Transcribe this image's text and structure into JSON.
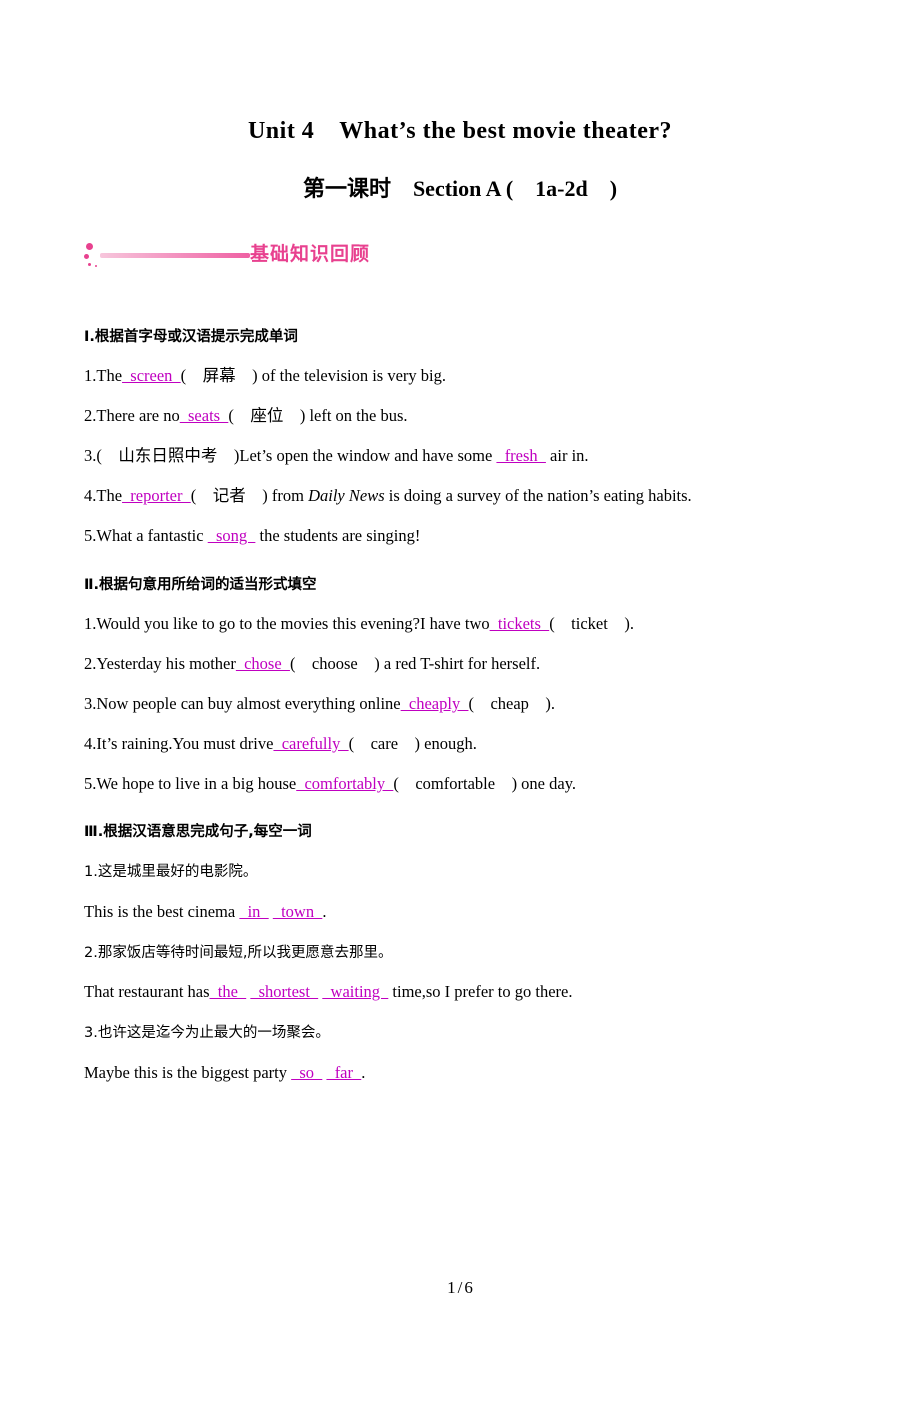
{
  "title": {
    "main": "Unit 4  What’s the best movie theater?",
    "sub": "第一课时  Section A (  1a-2d  )"
  },
  "banner": {
    "label": "基础知识回顾",
    "accent_color": "#e8418f"
  },
  "sections": [
    {
      "heading": "Ⅰ.根据首字母或汉语提示完成单词",
      "items": [
        {
          "parts": [
            {
              "t": "1.The",
              "k": "plain"
            },
            {
              "t": "  screen  ",
              "k": "answer"
            },
            {
              "t": "(  屏幕  ) of the television is very big.",
              "k": "plain"
            }
          ]
        },
        {
          "parts": [
            {
              "t": "2.There are no",
              "k": "plain"
            },
            {
              "t": "  seats  ",
              "k": "answer"
            },
            {
              "t": "(  座位  ) left on the bus.",
              "k": "plain"
            }
          ]
        },
        {
          "parts": [
            {
              "t": "3.(  山东日照中考  )Let’s open the window and have some ",
              "k": "plain"
            },
            {
              "t": "  fresh  ",
              "k": "answer"
            },
            {
              "t": " air in.",
              "k": "plain"
            }
          ]
        },
        {
          "parts": [
            {
              "t": "4.The",
              "k": "plain"
            },
            {
              "t": "  reporter  ",
              "k": "answer"
            },
            {
              "t": "(  记者  ) from ",
              "k": "plain"
            },
            {
              "t": "Daily News",
              "k": "italic"
            },
            {
              "t": " is doing a survey of the nation’s eating habits.",
              "k": "plain"
            }
          ]
        },
        {
          "parts": [
            {
              "t": "5.What a fantastic ",
              "k": "plain"
            },
            {
              "t": "  song  ",
              "k": "answer"
            },
            {
              "t": " the students are singing!",
              "k": "plain"
            }
          ]
        }
      ]
    },
    {
      "heading": "Ⅱ.根据句意用所给词的适当形式填空",
      "items": [
        {
          "parts": [
            {
              "t": "1.Would you like to go to the movies this evening?I have two",
              "k": "plain"
            },
            {
              "t": "  tickets  ",
              "k": "answer"
            },
            {
              "t": "(  ticket  ).",
              "k": "plain"
            }
          ]
        },
        {
          "parts": [
            {
              "t": "2.Yesterday his mother",
              "k": "plain"
            },
            {
              "t": "  chose  ",
              "k": "answer"
            },
            {
              "t": "(  choose  ) a red T-shirt for herself.",
              "k": "plain"
            }
          ]
        },
        {
          "parts": [
            {
              "t": "3.Now people can buy almost everything online",
              "k": "plain"
            },
            {
              "t": "  cheaply  ",
              "k": "answer"
            },
            {
              "t": "(  cheap  ).",
              "k": "plain"
            }
          ]
        },
        {
          "parts": [
            {
              "t": "4.It’s raining.You must drive",
              "k": "plain"
            },
            {
              "t": "  carefully  ",
              "k": "answer"
            },
            {
              "t": "(  care  ) enough.",
              "k": "plain"
            }
          ]
        },
        {
          "parts": [
            {
              "t": "5.We hope to live in a big house",
              "k": "plain"
            },
            {
              "t": "  comfortably  ",
              "k": "answer"
            },
            {
              "t": "(  comfortable  ) one day.",
              "k": "plain"
            }
          ]
        }
      ]
    },
    {
      "heading": "Ⅲ.根据汉语意思完成句子,每空一词",
      "items": [
        {
          "parts": [
            {
              "t": "1.这是城里最好的电影院。",
              "k": "cjk"
            }
          ]
        },
        {
          "parts": [
            {
              "t": "This is the best cinema ",
              "k": "plain"
            },
            {
              "t": "  in  ",
              "k": "answer"
            },
            {
              "t": " ",
              "k": "plain"
            },
            {
              "t": "  town  ",
              "k": "answer"
            },
            {
              "t": ".",
              "k": "plain"
            }
          ]
        },
        {
          "parts": [
            {
              "t": "2.那家饭店等待时间最短,所以我更愿意去那里。",
              "k": "cjk"
            }
          ]
        },
        {
          "parts": [
            {
              "t": "That restaurant has",
              "k": "plain"
            },
            {
              "t": "  the  ",
              "k": "answer"
            },
            {
              "t": " ",
              "k": "plain"
            },
            {
              "t": "  shortest  ",
              "k": "answer"
            },
            {
              "t": " ",
              "k": "plain"
            },
            {
              "t": "  waiting  ",
              "k": "answer"
            },
            {
              "t": " time,so I prefer to go there.",
              "k": "plain"
            }
          ]
        },
        {
          "parts": [
            {
              "t": "3.也许这是迄今为止最大的一场聚会。",
              "k": "cjk"
            }
          ]
        },
        {
          "parts": [
            {
              "t": "Maybe this is the biggest party ",
              "k": "plain"
            },
            {
              "t": "  so  ",
              "k": "answer"
            },
            {
              "t": " ",
              "k": "plain"
            },
            {
              "t": "  far  ",
              "k": "answer"
            },
            {
              "t": ".",
              "k": "plain"
            }
          ]
        }
      ]
    }
  ],
  "footer": {
    "current_page": "1",
    "separator": "/",
    "total_pages": "6"
  }
}
